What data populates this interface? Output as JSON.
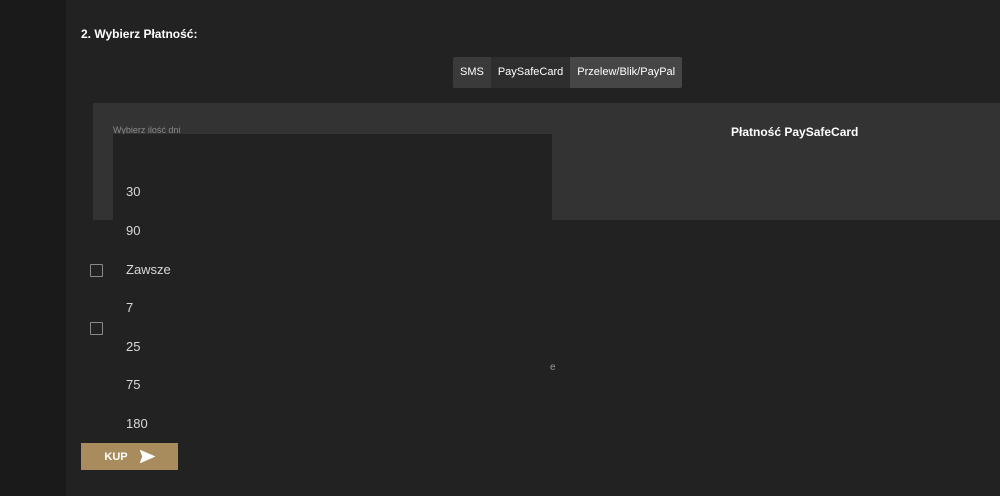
{
  "section": {
    "title": "2. Wybierz Płatność:"
  },
  "tabs": [
    {
      "label": "SMS"
    },
    {
      "label": "PaySafeCard"
    },
    {
      "label": "Przelew/Blik/PayPal"
    }
  ],
  "panel": {
    "select_label": "Wybierz ilość dni",
    "payment_title": "Płatność PaySafeCard"
  },
  "dropdown": {
    "options": [
      "30",
      "90",
      "Zawsze",
      "7",
      "25",
      "75",
      "180"
    ]
  },
  "partial_text": "e",
  "buy_button": {
    "label": "KUP",
    "icon": "send-icon"
  },
  "colors": {
    "accent": "#a88c5d",
    "background": "#222222",
    "panel": "#333333"
  }
}
